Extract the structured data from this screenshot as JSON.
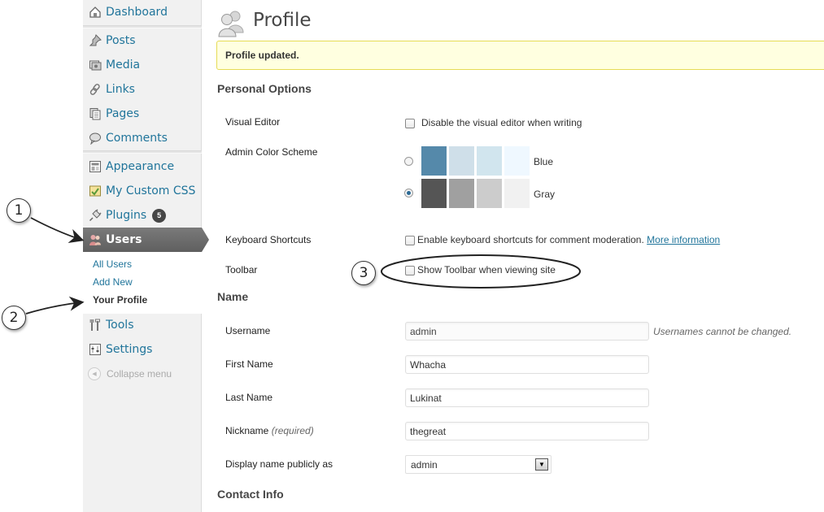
{
  "sidebar": {
    "items": [
      {
        "label": "Dashboard",
        "icon": "dashboard-icon"
      },
      {
        "label": "Posts",
        "icon": "pushpin-icon"
      },
      {
        "label": "Media",
        "icon": "media-icon"
      },
      {
        "label": "Links",
        "icon": "chain-link-icon"
      },
      {
        "label": "Pages",
        "icon": "pages-icon"
      },
      {
        "label": "Comments",
        "icon": "speech-bubble-icon"
      },
      {
        "label": "Appearance",
        "icon": "appearance-icon"
      },
      {
        "label": "My Custom CSS",
        "icon": "custom-css-icon"
      },
      {
        "label": "Plugins",
        "icon": "plug-icon",
        "badge": "5"
      },
      {
        "label": "Users",
        "icon": "users-icon"
      },
      {
        "label": "Tools",
        "icon": "tools-icon"
      },
      {
        "label": "Settings",
        "icon": "settings-icon"
      }
    ],
    "users_submenu": [
      "All Users",
      "Add New",
      "Your Profile"
    ],
    "collapse_label": "Collapse menu"
  },
  "page": {
    "title": "Profile",
    "notice": "Profile updated."
  },
  "personal_options": {
    "heading": "Personal Options",
    "visual_editor_label": "Visual Editor",
    "visual_editor_text": "Disable the visual editor when writing",
    "color_scheme_label": "Admin Color Scheme",
    "schemes": [
      {
        "name": "Blue",
        "selected": false,
        "colors": [
          "#5589aa",
          "#cfdfe9",
          "#d1e5ee",
          "#eff8ff"
        ]
      },
      {
        "name": "Gray",
        "selected": true,
        "colors": [
          "#555555",
          "#a0a0a0",
          "#cccccc",
          "#f1f1f1"
        ]
      }
    ],
    "shortcuts_label": "Keyboard Shortcuts",
    "shortcuts_text": "Enable keyboard shortcuts for comment moderation.",
    "shortcuts_link": "More information",
    "toolbar_label": "Toolbar",
    "toolbar_text": "Show Toolbar when viewing site"
  },
  "name_section": {
    "heading": "Name",
    "username_label": "Username",
    "username_value": "admin",
    "username_hint": "Usernames cannot be changed.",
    "first_name_label": "First Name",
    "first_name_value": "Whacha",
    "last_name_label": "Last Name",
    "last_name_value": "Lukinat",
    "nickname_label": "Nickname",
    "nickname_required": "(required)",
    "nickname_value": "thegreat",
    "display_name_label": "Display name publicly as",
    "display_name_value": "admin"
  },
  "contact_section": {
    "heading": "Contact Info"
  },
  "annotations": [
    "1",
    "2",
    "3"
  ],
  "colors": {
    "link": "#21759b",
    "notice_bg": "#ffffe0",
    "notice_border": "#e6db55",
    "active_menu": "#6d6d6d"
  }
}
